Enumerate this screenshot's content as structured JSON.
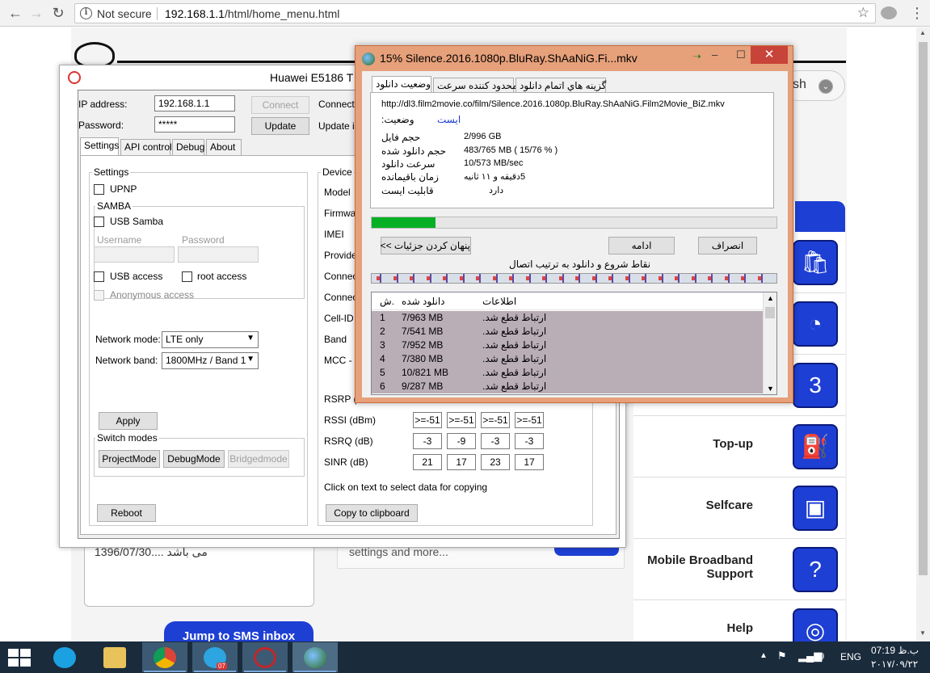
{
  "browser": {
    "security_label": "Not secure",
    "url_host": "192.168.1.1",
    "url_path": "/html/home_menu.html"
  },
  "webpage": {
    "search_stub": "sh",
    "sms_preview": "1396/07/30.... می باشد",
    "settings_preview": "settings and more...",
    "jump_button": "Jump to SMS inbox",
    "menu": [
      {
        "label": "Top-up",
        "icon": "fuel-pump-icon"
      },
      {
        "label": "Selfcare",
        "icon": "id-card-icon"
      },
      {
        "label": "Mobile Broadband Support",
        "icon": "question-icon"
      },
      {
        "label": "Help",
        "icon": "lifebuoy-icon"
      }
    ]
  },
  "hw": {
    "title": "Huawei E5186 T",
    "ip_label": "IP address:",
    "ip_value": "192.168.1.1",
    "password_label": "Password:",
    "password_value": "*****",
    "connect_button": "Connect",
    "update_button": "Update",
    "connection_label": "Connectio",
    "update_info_label": "Update in",
    "tabs": [
      "Settings",
      "API control",
      "Debug",
      "About"
    ],
    "settings_group": "Settings",
    "upnp": "UPNP",
    "samba_group": "SAMBA",
    "usb_samba": "USB Samba",
    "username_placeholder": "Username",
    "password_placeholder": "Password",
    "usb_access": "USB access",
    "root_access": "root access",
    "anonymous_access": "Anonymous access",
    "network_mode_label": "Network mode:",
    "network_mode_value": "LTE only",
    "network_band_label": "Network band:",
    "network_band_value": "1800MHz / Band 1",
    "apply_button": "Apply",
    "switch_modes_group": "Switch modes",
    "project_mode": "ProjectMode",
    "debug_mode": "DebugMode",
    "bridged_mode": "Bridgedmode",
    "reboot_button": "Reboot",
    "device_group": "Device",
    "device_labels": [
      "Model",
      "Firmwar",
      "IMEI",
      "Provider",
      "Connec",
      "Connec",
      "Cell-ID H",
      "Band",
      "MCC - M"
    ],
    "rsrp_label": "RSRP (",
    "rssi_label": "RSSI (dBm)",
    "rssi_values": [
      ">=-51",
      ">=-51",
      ">=-51",
      ">=-51"
    ],
    "rsrq_label": "RSRQ (dB)",
    "rsrq_values": [
      "-3",
      "-9",
      "-3",
      "-3"
    ],
    "sinr_label": "SINR (dB)",
    "sinr_values": [
      "21",
      "17",
      "23",
      "17"
    ],
    "copy_hint": "Click on text to select data for copying",
    "copy_button": "Copy to clipboard"
  },
  "idm": {
    "title": "15% Silence.2016.1080p.BluRay.ShAaNiG.Fi...mkv",
    "minimize": "–",
    "maximize": "☐",
    "close": "✕",
    "tabs": [
      "وضعیت دانلود",
      "محدود کننده سرعت",
      "گزینه هاي اتمام دانلود"
    ],
    "url": "http://dl3.film2movie.co/film/Silence.2016.1080p.BluRay.ShAaNiG.Film2Movie_BiZ.mkv",
    "status_label": "وضعیت:",
    "status_value": "ایست",
    "info_rows": [
      {
        "label": "حجم فایل",
        "value": "2/996  GB"
      },
      {
        "label": "حجم دانلود شده",
        "value": "483/765  MB  ( 15/76 % )"
      },
      {
        "label": "سرعت دانلود",
        "value": "10/573  MB/sec"
      },
      {
        "label": "زمان باقیمانده",
        "value": "5دقیقه و  ١١ ثانیه"
      },
      {
        "label": "قابلیت ایست",
        "value": "دارد"
      }
    ],
    "progress_percent": 15.76,
    "hide_details_button": "پنهان کردن جزئیات >>",
    "resume_button": "ادامه",
    "cancel_button": "انصراف",
    "connections_caption": "نقاط شروع و دانلود به ترتیب اتصال",
    "list_headers": [
      "ش.",
      "دانلود شده",
      "اطلاعات"
    ],
    "list_rows": [
      {
        "n": "1",
        "size": "7/963  MB",
        "info": "ارتباط قطع شد."
      },
      {
        "n": "2",
        "size": "7/541  MB",
        "info": "ارتباط قطع شد."
      },
      {
        "n": "3",
        "size": "7/952  MB",
        "info": "ارتباط قطع شد."
      },
      {
        "n": "4",
        "size": "7/380  MB",
        "info": "ارتباط قطع شد."
      },
      {
        "n": "5",
        "size": "10/821  MB",
        "info": "ارتباط قطع شد."
      },
      {
        "n": "6",
        "size": "9/287  MB",
        "info": "ارتباط قطع شد."
      }
    ]
  },
  "taskbar": {
    "telegram_badge": "07",
    "language": "ENG",
    "time": "07:19 ب.ظ",
    "date": "۲۰۱۷/۰۹/۲۲"
  }
}
